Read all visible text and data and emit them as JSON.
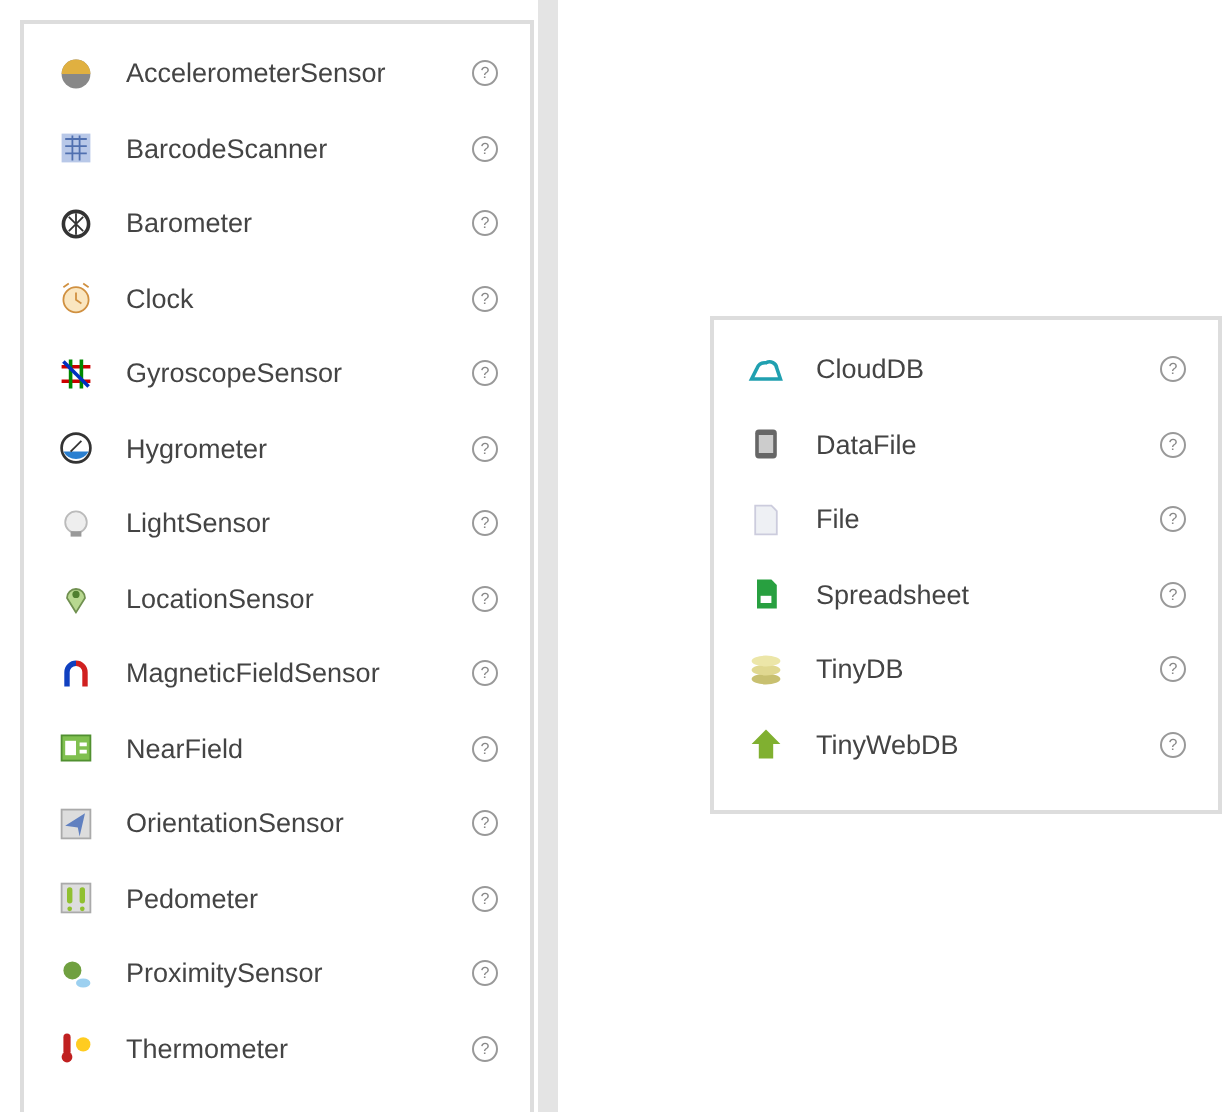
{
  "sensor_panel": {
    "items": [
      {
        "label": "AccelerometerSensor",
        "kind": "accelerometer",
        "help": "?"
      },
      {
        "label": "BarcodeScanner",
        "kind": "barcode",
        "help": "?"
      },
      {
        "label": "Barometer",
        "kind": "barometer",
        "help": "?"
      },
      {
        "label": "Clock",
        "kind": "clock",
        "help": "?"
      },
      {
        "label": "GyroscopeSensor",
        "kind": "gyroscope",
        "help": "?"
      },
      {
        "label": "Hygrometer",
        "kind": "hygrometer",
        "help": "?"
      },
      {
        "label": "LightSensor",
        "kind": "light",
        "help": "?"
      },
      {
        "label": "LocationSensor",
        "kind": "location",
        "help": "?"
      },
      {
        "label": "MagneticFieldSensor",
        "kind": "magnet",
        "help": "?"
      },
      {
        "label": "NearField",
        "kind": "nearfield",
        "help": "?"
      },
      {
        "label": "OrientationSensor",
        "kind": "orientation",
        "help": "?"
      },
      {
        "label": "Pedometer",
        "kind": "pedometer",
        "help": "?"
      },
      {
        "label": "ProximitySensor",
        "kind": "proximity",
        "help": "?"
      },
      {
        "label": "Thermometer",
        "kind": "thermometer",
        "help": "?"
      }
    ]
  },
  "storage_panel": {
    "items": [
      {
        "label": "CloudDB",
        "kind": "cloud",
        "help": "?"
      },
      {
        "label": "DataFile",
        "kind": "datafile",
        "help": "?"
      },
      {
        "label": "File",
        "kind": "file",
        "help": "?"
      },
      {
        "label": "Spreadsheet",
        "kind": "spreadsheet",
        "help": "?"
      },
      {
        "label": "TinyDB",
        "kind": "database",
        "help": "?"
      },
      {
        "label": "TinyWebDB",
        "kind": "uparrow",
        "help": "?"
      }
    ]
  }
}
